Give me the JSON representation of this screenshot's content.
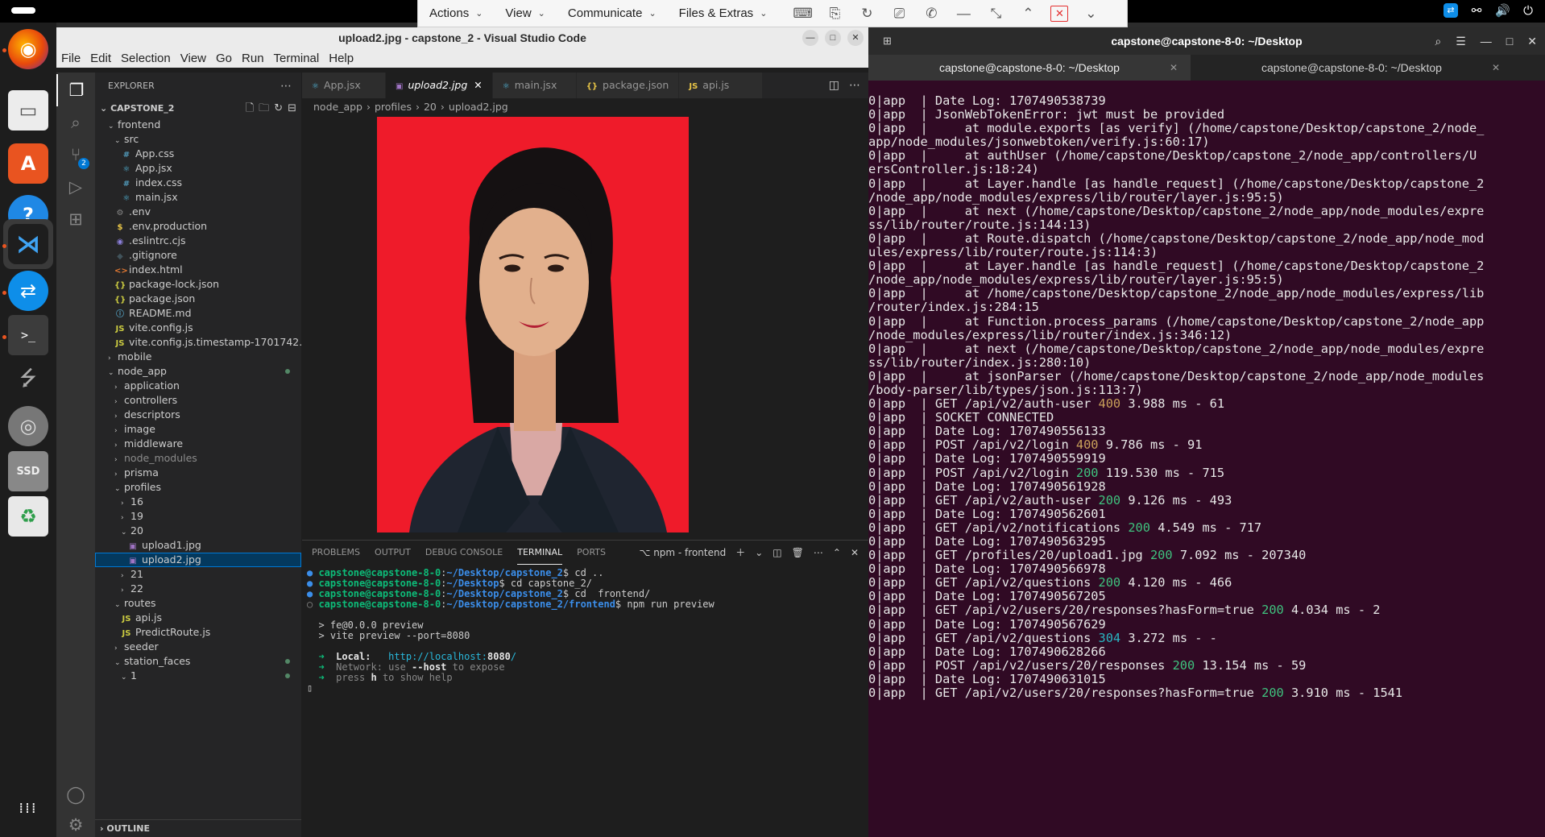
{
  "teamviewer": {
    "menus": [
      "Actions",
      "View",
      "Communicate",
      "Files & Extras"
    ]
  },
  "vscode": {
    "title": "upload2.jpg - capstone_2 - Visual Studio Code",
    "menu": [
      "File",
      "Edit",
      "Selection",
      "View",
      "Go",
      "Run",
      "Terminal",
      "Help"
    ],
    "explorer_label": "EXPLORER",
    "project": "CAPSTONE_2",
    "outline_label": "OUTLINE",
    "tree": [
      {
        "label": "frontend",
        "indent": 1,
        "type": "folder-open"
      },
      {
        "label": "src",
        "indent": 2,
        "type": "folder-open"
      },
      {
        "label": "App.css",
        "indent": 3,
        "type": "css"
      },
      {
        "label": "App.jsx",
        "indent": 3,
        "type": "react"
      },
      {
        "label": "index.css",
        "indent": 3,
        "type": "css"
      },
      {
        "label": "main.jsx",
        "indent": 3,
        "type": "react"
      },
      {
        "label": ".env",
        "indent": 2,
        "type": "gear"
      },
      {
        "label": ".env.production",
        "indent": 2,
        "type": "dollar"
      },
      {
        "label": ".eslintrc.cjs",
        "indent": 2,
        "type": "eslint"
      },
      {
        "label": ".gitignore",
        "indent": 2,
        "type": "git"
      },
      {
        "label": "index.html",
        "indent": 2,
        "type": "html"
      },
      {
        "label": "package-lock.json",
        "indent": 2,
        "type": "json"
      },
      {
        "label": "package.json",
        "indent": 2,
        "type": "json"
      },
      {
        "label": "README.md",
        "indent": 2,
        "type": "info"
      },
      {
        "label": "vite.config.js",
        "indent": 2,
        "type": "js"
      },
      {
        "label": "vite.config.js.timestamp-1701742...",
        "indent": 2,
        "type": "js"
      },
      {
        "label": "mobile",
        "indent": 1,
        "type": "folder"
      },
      {
        "label": "node_app",
        "indent": 1,
        "type": "folder-open",
        "mod": true
      },
      {
        "label": "application",
        "indent": 2,
        "type": "folder"
      },
      {
        "label": "controllers",
        "indent": 2,
        "type": "folder"
      },
      {
        "label": "descriptors",
        "indent": 2,
        "type": "folder"
      },
      {
        "label": "image",
        "indent": 2,
        "type": "folder"
      },
      {
        "label": "middleware",
        "indent": 2,
        "type": "folder"
      },
      {
        "label": "node_modules",
        "indent": 2,
        "type": "folder",
        "dim": true
      },
      {
        "label": "prisma",
        "indent": 2,
        "type": "folder"
      },
      {
        "label": "profiles",
        "indent": 2,
        "type": "folder-open"
      },
      {
        "label": "16",
        "indent": 3,
        "type": "folder"
      },
      {
        "label": "19",
        "indent": 3,
        "type": "folder"
      },
      {
        "label": "20",
        "indent": 3,
        "type": "folder-open"
      },
      {
        "label": "upload1.jpg",
        "indent": 4,
        "type": "image"
      },
      {
        "label": "upload2.jpg",
        "indent": 4,
        "type": "image",
        "selected": true
      },
      {
        "label": "21",
        "indent": 3,
        "type": "folder"
      },
      {
        "label": "22",
        "indent": 3,
        "type": "folder"
      },
      {
        "label": "routes",
        "indent": 2,
        "type": "folder-open"
      },
      {
        "label": "api.js",
        "indent": 3,
        "type": "js"
      },
      {
        "label": "PredictRoute.js",
        "indent": 3,
        "type": "js"
      },
      {
        "label": "seeder",
        "indent": 2,
        "type": "folder"
      },
      {
        "label": "station_faces",
        "indent": 2,
        "type": "folder-open",
        "mod": true
      },
      {
        "label": "1",
        "indent": 3,
        "type": "folder-open",
        "mod": true
      }
    ],
    "tabs": [
      {
        "label": "App.jsx",
        "icon": "react"
      },
      {
        "label": "upload2.jpg",
        "icon": "img",
        "active": true
      },
      {
        "label": "main.jsx",
        "icon": "react"
      },
      {
        "label": "package.json",
        "icon": "json"
      },
      {
        "label": "api.js",
        "icon": "js"
      }
    ],
    "breadcrumb": [
      "node_app",
      "profiles",
      "20",
      "upload2.jpg"
    ],
    "panel_tabs": [
      "PROBLEMS",
      "OUTPUT",
      "DEBUG CONSOLE",
      "TERMINAL",
      "PORTS"
    ],
    "panel_active": "TERMINAL",
    "panel_terminal_name": "npm - frontend",
    "terminal": {
      "prompt_user": "capstone@capstone-8-0",
      "lines": [
        {
          "bullet": "●",
          "path": "~/Desktop/capstone_2",
          "cmd": "$ cd .."
        },
        {
          "bullet": "●",
          "path": "~/Desktop",
          "cmd": "$ cd capstone_2/"
        },
        {
          "bullet": "●",
          "path": "~/Desktop/capstone_2",
          "cmd": "$ cd  frontend/"
        },
        {
          "bullet": "○",
          "path": "~/Desktop/capstone_2/frontend",
          "cmd": "$ npm run preview"
        }
      ],
      "out1": "> fe@0.0.0 preview",
      "out2": "> vite preview --port=8080",
      "local_label": "Local:",
      "local_url_pre": "http://localhost:",
      "local_url_port": "8080",
      "local_url_post": "/",
      "network_label": "Network:",
      "network_text_pre": "use ",
      "network_text_flag": "--host",
      "network_text_post": " to expose",
      "help_pre": "press ",
      "help_key": "h",
      "help_post": " to show help"
    }
  },
  "terminal_window": {
    "title": "capstone@capstone-8-0: ~/Desktop",
    "tabs": [
      "capstone@capstone-8-0: ~/Desktop",
      "capstone@capstone-8-0: ~/Desktop"
    ],
    "lines": [
      {
        "t": "0|app  | Date Log: 1707490538739"
      },
      {
        "t": "0|app  | JsonWebTokenError: jwt must be provided"
      },
      {
        "t": "0|app  |     at module.exports [as verify] (/home/capstone/Desktop/capstone_2/node_"
      },
      {
        "t": "app/node_modules/jsonwebtoken/verify.js:60:17)"
      },
      {
        "t": "0|app  |     at authUser (/home/capstone/Desktop/capstone_2/node_app/controllers/U"
      },
      {
        "t": "ersController.js:18:24)"
      },
      {
        "t": "0|app  |     at Layer.handle [as handle_request] (/home/capstone/Desktop/capstone_2"
      },
      {
        "t": "/node_app/node_modules/express/lib/router/layer.js:95:5)"
      },
      {
        "t": "0|app  |     at next (/home/capstone/Desktop/capstone_2/node_app/node_modules/expre"
      },
      {
        "t": "ss/lib/router/route.js:144:13)"
      },
      {
        "t": "0|app  |     at Route.dispatch (/home/capstone/Desktop/capstone_2/node_app/node_mod"
      },
      {
        "t": "ules/express/lib/router/route.js:114:3)"
      },
      {
        "t": "0|app  |     at Layer.handle [as handle_request] (/home/capstone/Desktop/capstone_2"
      },
      {
        "t": "/node_app/node_modules/express/lib/router/layer.js:95:5)"
      },
      {
        "t": "0|app  |     at /home/capstone/Desktop/capstone_2/node_app/node_modules/express/lib"
      },
      {
        "t": "/router/index.js:284:15"
      },
      {
        "t": "0|app  |     at Function.process_params (/home/capstone/Desktop/capstone_2/node_app"
      },
      {
        "t": "/node_modules/express/lib/router/index.js:346:12)"
      },
      {
        "t": "0|app  |     at next (/home/capstone/Desktop/capstone_2/node_app/node_modules/expre"
      },
      {
        "t": "ss/lib/router/index.js:280:10)"
      },
      {
        "t": "0|app  |     at jsonParser (/home/capstone/Desktop/capstone_2/node_app/node_modules"
      },
      {
        "t": "/body-parser/lib/types/json.js:113:7)"
      },
      {
        "t": "0|app  | GET /api/v2/auth-user ",
        "s": "400",
        "r": " 3.988 ms - 61"
      },
      {
        "t": "0|app  | SOCKET CONNECTED"
      },
      {
        "t": "0|app  | Date Log: 1707490556133"
      },
      {
        "t": "0|app  | POST /api/v2/login ",
        "s": "400",
        "r": " 9.786 ms - 91"
      },
      {
        "t": "0|app  | Date Log: 1707490559919"
      },
      {
        "t": "0|app  | POST /api/v2/login ",
        "s": "200",
        "r": " 119.530 ms - 715"
      },
      {
        "t": "0|app  | Date Log: 1707490561928"
      },
      {
        "t": "0|app  | GET /api/v2/auth-user ",
        "s": "200",
        "r": " 9.126 ms - 493"
      },
      {
        "t": "0|app  | Date Log: 1707490562601"
      },
      {
        "t": "0|app  | GET /api/v2/notifications ",
        "s": "200",
        "r": " 4.549 ms - 717"
      },
      {
        "t": "0|app  | Date Log: 1707490563295"
      },
      {
        "t": "0|app  | GET /profiles/20/upload1.jpg ",
        "s": "200",
        "r": " 7.092 ms - 207340"
      },
      {
        "t": "0|app  | Date Log: 1707490566978"
      },
      {
        "t": "0|app  | GET /api/v2/questions ",
        "s": "200",
        "r": " 4.120 ms - 466"
      },
      {
        "t": "0|app  | Date Log: 1707490567205"
      },
      {
        "t": "0|app  | GET /api/v2/users/20/responses?hasForm=true ",
        "s": "200",
        "r": " 4.034 ms - 2"
      },
      {
        "t": "0|app  | Date Log: 1707490567629"
      },
      {
        "t": "0|app  | GET /api/v2/questions ",
        "s": "304",
        "r": " 3.272 ms - -"
      },
      {
        "t": "0|app  | Date Log: 1707490628266"
      },
      {
        "t": "0|app  | POST /api/v2/users/20/responses ",
        "s": "200",
        "r": " 13.154 ms - 59"
      },
      {
        "t": "0|app  | Date Log: 1707490631015"
      },
      {
        "t": "0|app  | GET /api/v2/users/20/responses?hasForm=true ",
        "s": "200",
        "r": " 3.910 ms - 1541"
      }
    ]
  }
}
